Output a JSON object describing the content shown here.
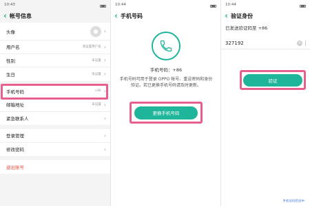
{
  "screen1": {
    "time": "10:43",
    "title": "帐号信息",
    "rows": [
      {
        "label": "头像",
        "value": ""
      },
      {
        "label": "用户名",
        "value": "请设置用户名"
      },
      {
        "label": "性别",
        "value": "未设置"
      },
      {
        "label": "生日",
        "value": "未设置"
      },
      {
        "label": "手机号码",
        "value": "+86"
      },
      {
        "label": "邮箱地址",
        "value": "未设置"
      },
      {
        "label": "紧急联系人",
        "value": ""
      }
    ],
    "rows2": [
      {
        "label": "登录管理"
      },
      {
        "label": "修改密码"
      }
    ],
    "logout": "退出账号"
  },
  "screen2": {
    "time": "10:44",
    "title": "手机号码",
    "phone_label": "手机号码：+86",
    "desc": "手机号码可用于登录 OPPO 帐号、重设密码和身份验证。若已更换手机号码请及时更新。",
    "button": "更换手机号码"
  },
  "screen3": {
    "time": "10:44",
    "title": "验证身份",
    "sent": "已发送验证码至 +86",
    "code": "327192",
    "button": "验证",
    "bottom_link": "手机号码检验中"
  },
  "colors": {
    "accent": "#1fb59a",
    "highlight": "#e75f8c",
    "danger": "#e74c3c"
  }
}
